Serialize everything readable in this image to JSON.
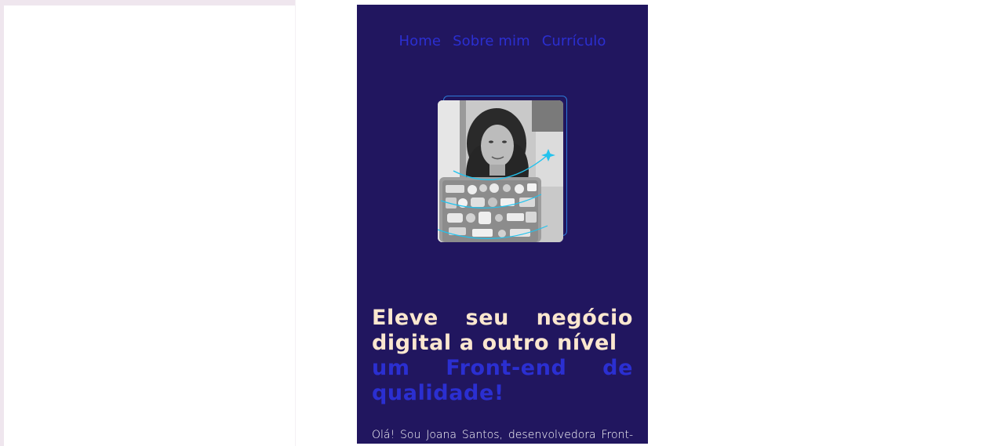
{
  "nav": {
    "items": [
      {
        "label": "Home"
      },
      {
        "label": "Sobre mim"
      },
      {
        "label": "Currículo"
      }
    ]
  },
  "hero": {
    "photo_alt": "Joana Santos com laptop cheio de adesivos",
    "headline_light": "Eleve seu negócio digital a outro nível",
    "headline_blue": "um Front-end de qualidade!",
    "intro": "Olá! Sou Joana Santos, desenvolvedora Front-end com especialidade em React,"
  },
  "colors": {
    "background": "#21165f",
    "accent_blue": "#2b2fd1",
    "headline_cream": "#fbe7cf",
    "frame_blue": "#2c7bd8",
    "arc_cyan": "#22c3ee"
  }
}
